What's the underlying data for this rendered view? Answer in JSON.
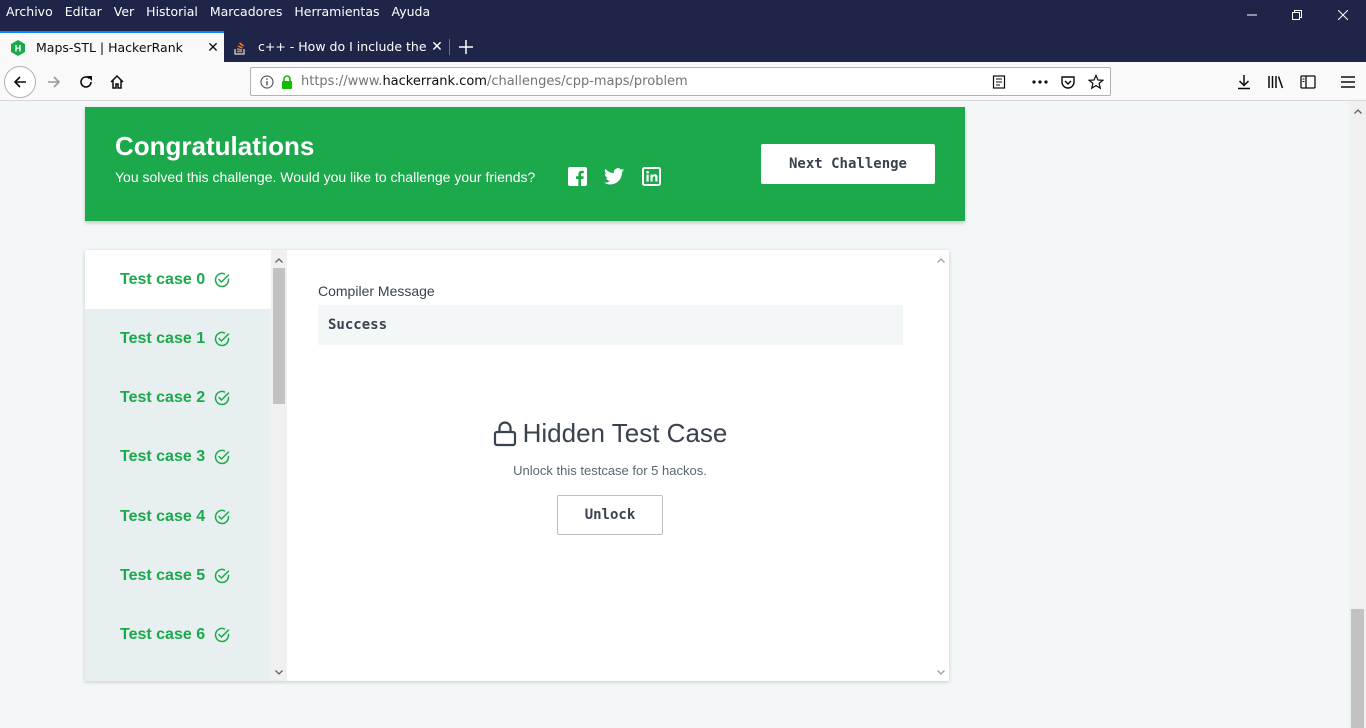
{
  "browser": {
    "menu": [
      "Archivo",
      "Editar",
      "Ver",
      "Historial",
      "Marcadores",
      "Herramientas",
      "Ayuda"
    ],
    "tabs": [
      {
        "label": "Maps-STL | HackerRank",
        "icon": "hackerrank-icon",
        "active": true
      },
      {
        "label": "c++ - How do I include the strin",
        "icon": "stackoverflow-icon",
        "active": false
      }
    ],
    "url": {
      "prefix": "https://www.",
      "domain": "hackerrank.com",
      "path": "/challenges/cpp-maps/problem"
    }
  },
  "banner": {
    "title": "Congratulations",
    "subtitle": "You solved this challenge. Would you like to challenge your friends?",
    "next_label": "Next Challenge",
    "color": "#1ba94c"
  },
  "testcases": [
    {
      "label": "Test case 0",
      "status": "passed"
    },
    {
      "label": "Test case 1",
      "status": "passed"
    },
    {
      "label": "Test case 2",
      "status": "passed"
    },
    {
      "label": "Test case 3",
      "status": "passed"
    },
    {
      "label": "Test case 4",
      "status": "passed"
    },
    {
      "label": "Test case 5",
      "status": "passed"
    },
    {
      "label": "Test case 6",
      "status": "passed"
    }
  ],
  "result": {
    "compiler_label": "Compiler Message",
    "compiler_message": "Success",
    "hidden_title": "Hidden Test Case",
    "hidden_sub": "Unlock this testcase for 5 hackos.",
    "unlock_label": "Unlock"
  }
}
